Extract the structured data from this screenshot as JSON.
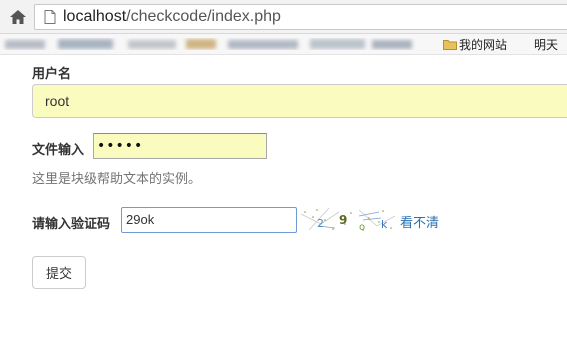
{
  "browser": {
    "url_host": "localhost",
    "url_path": "/checkcode/index.php",
    "bookmarks": [
      {
        "label": "我的网站",
        "icon": "folder-icon"
      },
      {
        "label": "明天",
        "icon": null
      }
    ]
  },
  "form": {
    "username_label": "用户名",
    "username_value": "root",
    "file_label": "文件输入",
    "password_value": "•••••",
    "help_text": "这里是块级帮助文本的实例。",
    "captcha_label": "请输入验证码",
    "captcha_value": "29ok",
    "captcha_image_text": [
      "2",
      "9",
      "o",
      "k"
    ],
    "cant_see_link": "看不清",
    "submit_label": "提交"
  },
  "colors": {
    "autofill_bg": "#fafcbf",
    "link": "#2a6fb0",
    "focus_border": "#6f9ad8"
  }
}
